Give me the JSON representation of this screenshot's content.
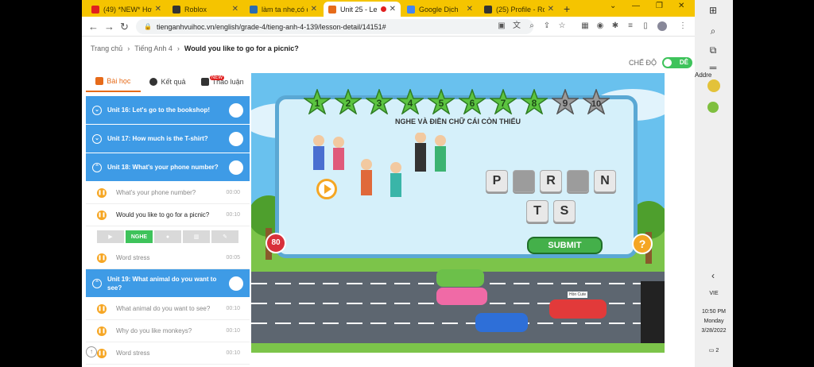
{
  "browser": {
    "tabs": [
      {
        "title": "(49) *NEW* How",
        "favicon_color": "#e02020"
      },
      {
        "title": "Roblox",
        "favicon_color": "#333333"
      },
      {
        "title": "làm ta nhe,có đủ",
        "favicon_color": "#2b6cb0"
      },
      {
        "title": "Unit 25 - Le",
        "favicon_color": "#e66b1a"
      },
      {
        "title": "Google Dịch",
        "favicon_color": "#4285f4"
      },
      {
        "title": "(25) Profile - Rol",
        "favicon_color": "#333333"
      }
    ],
    "new_tab": "+",
    "url": "tienganhvuihoc.vn/english/grade-4/tieng-anh-4-139/lesson-detail/14151#"
  },
  "breadcrumb": {
    "items": [
      "Trang chủ",
      "Tiếng Anh 4"
    ],
    "current": "Would you like to go for a picnic?"
  },
  "mode": {
    "label": "CHẾ ĐỘ",
    "toggle_label": "DÊ"
  },
  "panel_tabs": [
    {
      "label": "Bài học"
    },
    {
      "label": "Kết quả"
    },
    {
      "label": "Thảo luận"
    }
  ],
  "discussion_badge": "NEW",
  "units_top": [
    {
      "title": "Unit 16: Let's go to the bookshop!"
    },
    {
      "title": "Unit 17: How much is the T-shirt?"
    },
    {
      "title": "Unit 18: What's your phone number?"
    }
  ],
  "lessons_18": [
    {
      "title": "What's your phone number?",
      "duration": "00:00"
    },
    {
      "title": "Would you like to go for a picnic?",
      "duration": "00:10"
    }
  ],
  "subbar": {
    "active": "NGHE"
  },
  "word_stress": {
    "title": "Word stress",
    "duration": "00:05"
  },
  "unit_19": {
    "title": "Unit 19: What animal do you want to see?"
  },
  "lessons_19": [
    {
      "title": "What animal do you want to see?",
      "duration": "00:10"
    },
    {
      "title": "Why do you like monkeys?",
      "duration": "00:10"
    },
    {
      "title": "Word stress",
      "duration": "00:10"
    }
  ],
  "game": {
    "stars": [
      "1",
      "2",
      "3",
      "4",
      "5",
      "6",
      "7",
      "8",
      "9",
      "10"
    ],
    "completed_stars": 8,
    "instruction": "NGHE VÀ ĐIỀN CHỮ CÁI CÒN THIẾU",
    "row1": [
      "P",
      "",
      "R",
      "",
      "N"
    ],
    "row2": [
      "T",
      "S"
    ],
    "submit": "SUBMIT",
    "score": "80",
    "help": "?",
    "car_sign": "Hồn Cute"
  },
  "taskbar": {
    "side_label": "Addre",
    "language": "VIE",
    "time": "10:50 PM",
    "day": "Monday",
    "date": "3/28/2022",
    "notifications": "2"
  }
}
